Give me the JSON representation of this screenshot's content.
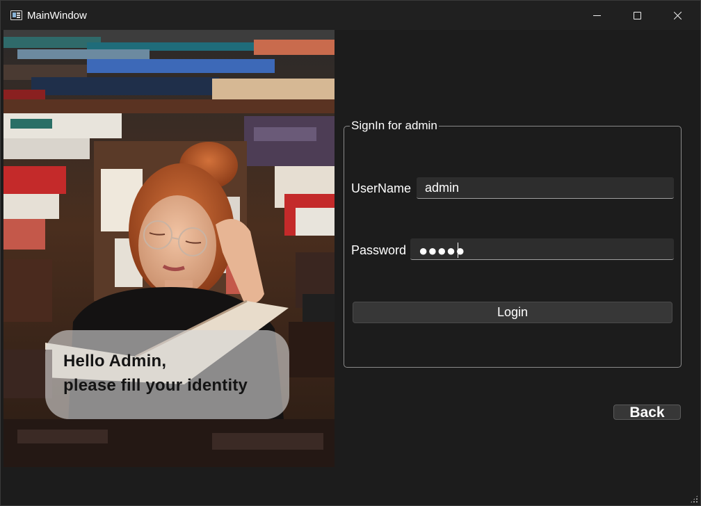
{
  "window": {
    "title": "MainWindow",
    "icon": "app-window-icon",
    "controls": [
      "minimize",
      "maximize",
      "close"
    ]
  },
  "image_panel": {
    "greeting_line1": "Hello Admin,",
    "greeting_line2": "please fill your identity"
  },
  "signin": {
    "group_title": "SignIn for admin",
    "username_label": "UserName",
    "username_value": "admin",
    "password_label": "Password",
    "password_mask": "●●●●●",
    "login_label": "Login"
  },
  "footer": {
    "back_label": "Back"
  },
  "colors": {
    "window_bg": "#1c1c1c",
    "titlebar_bg": "#202020",
    "input_bg": "#2d2d2d",
    "button_bg": "#373737",
    "text": "#ffffff"
  }
}
